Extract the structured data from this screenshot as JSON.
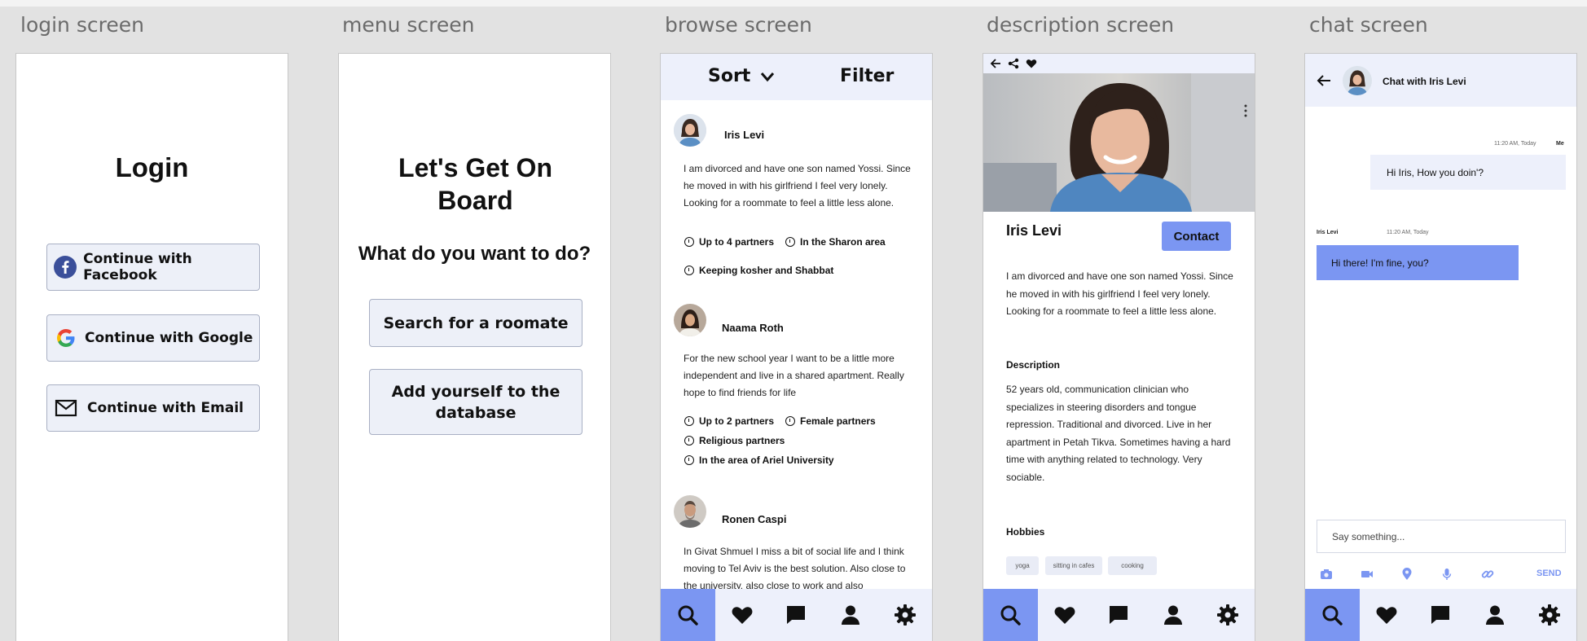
{
  "labels": {
    "login": "login screen",
    "menu": "menu screen",
    "browse": "browse screen",
    "description": "description screen",
    "chat": "chat screen"
  },
  "login": {
    "title": "Login",
    "facebook": "Continue with Facebook",
    "google": "Continue with Google",
    "email": "Continue with Email",
    "colors": {
      "facebook": "#3b4f9a",
      "google_blue": "#4285f4",
      "google_red": "#ea4335",
      "google_yellow": "#fbbc05",
      "google_green": "#34a853"
    }
  },
  "menu": {
    "title": "Let's Get On Board",
    "subtitle": "What do you want to do?",
    "search_button": "Search for a roomate",
    "add_button": "Add yourself to the database"
  },
  "browse": {
    "sort": "Sort",
    "filter": "Filter",
    "posts": [
      {
        "name": "Iris Levi",
        "text": "I am divorced and have one son named Yossi. Since he moved in with his girlfriend I feel very lonely. Looking for a roommate to feel a little less alone.",
        "tags": [
          "Up to 4 partners",
          "In the Sharon area",
          "Keeping kosher and Shabbat"
        ]
      },
      {
        "name": "Naama Roth",
        "text": "For the new school year I want to be a little more independent and live in a shared apartment. Really hope to find friends for life",
        "tags": [
          "Up to 2 partners",
          "Female partners",
          "Religious partners",
          "In the area of Ariel University"
        ]
      },
      {
        "name": "Ronen Caspi",
        "text": "In Givat Shmuel I miss a bit of social life and I think moving to Tel Aviv is the best solution. Also close to the university, also close to work and also"
      }
    ]
  },
  "description": {
    "name": "Iris Levi",
    "contact": "Contact",
    "intro": "I am divorced and have one son named Yossi. Since he moved in with his girlfriend I feel very lonely. Looking for a roommate to feel a little less alone.",
    "desc_heading": "Description",
    "desc_text": "52 years old, communication clinician who specializes in steering disorders and tongue repression. Traditional and divorced. Live in her apartment in Petah Tikva. Sometimes having a hard time with anything related to technology. Very sociable.",
    "hobbies_heading": "Hobbies",
    "hobbies": [
      "yoga",
      "sitting in cafes",
      "cooking"
    ]
  },
  "chat": {
    "title": "Chat with Iris Levi",
    "msg1_time": "11:20 AM, Today",
    "msg1_sender": "Me",
    "msg1_text": "Hi Iris, How you doin'?",
    "msg2_sender": "Iris Levi",
    "msg2_time": "11:20 AM, Today",
    "msg2_text": "Hi there! I'm fine, you?",
    "placeholder": "Say something...",
    "send": "SEND"
  },
  "colors": {
    "accent": "#7b96f2",
    "header_bg": "#edf0fb",
    "button_bg": "#edf0f8"
  }
}
